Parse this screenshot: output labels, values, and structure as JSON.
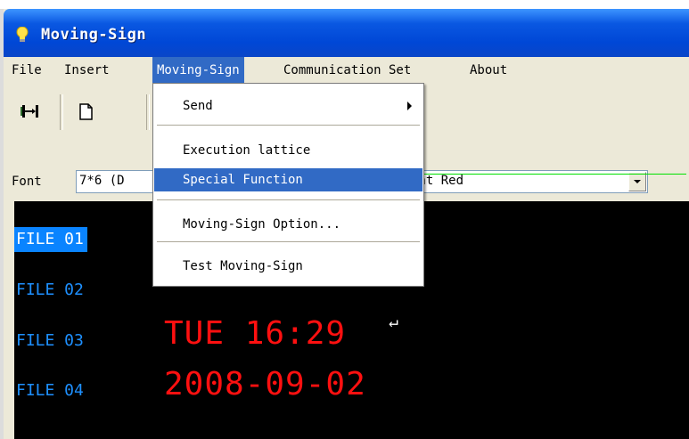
{
  "app": {
    "title": "Moving-Sign"
  },
  "menubar": {
    "items": [
      {
        "label": "File"
      },
      {
        "label": "Insert"
      },
      {
        "label": "Moving-Sign"
      },
      {
        "label": "Communication Set"
      },
      {
        "label": "About"
      }
    ]
  },
  "dropdown": {
    "items": [
      {
        "label": "Send"
      },
      {
        "label": "Execution lattice"
      },
      {
        "label": "Special Function"
      },
      {
        "label": "Moving-Sign Option..."
      },
      {
        "label": "Test Moving-Sign"
      }
    ]
  },
  "fontbar": {
    "label": "Font",
    "value": "7*6 (D",
    "color_value": "ght Red"
  },
  "files": [
    {
      "label": "FILE 01"
    },
    {
      "label": "FILE 02"
    },
    {
      "label": "FILE 03"
    },
    {
      "label": "FILE 04"
    }
  ],
  "display": {
    "line1": "TUE 16:29",
    "line2": "2008-09-02",
    "return_mark": "↵"
  },
  "colors": {
    "title_blue": "#0047d6",
    "highlight": "#316ac5",
    "led_red": "#ff1010",
    "file_blue": "#1e90ff",
    "guide_green": "#00e000"
  },
  "icons": {
    "app": "lightbulb-icon",
    "toolbar": [
      "connect-icon",
      "new-file-icon"
    ]
  }
}
